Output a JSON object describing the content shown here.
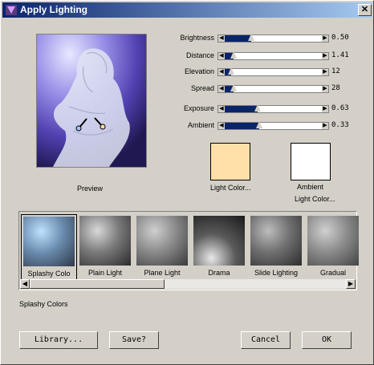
{
  "window": {
    "title": "Apply Lighting",
    "close_glyph": "✕"
  },
  "preview": {
    "label": "Preview"
  },
  "controls": [
    {
      "label": "Brightness",
      "value": "0.50",
      "level": 0.3
    },
    {
      "label": "Distance",
      "value": "1.41",
      "level": 0.14
    },
    {
      "label": "Elevation",
      "value": "12",
      "level": 0.12
    },
    {
      "label": "Spread",
      "value": "28",
      "level": 0.14
    },
    {
      "label": "Exposure",
      "value": "0.63",
      "level": 0.36
    },
    {
      "label": "Ambient",
      "value": "0.33",
      "level": 0.37
    }
  ],
  "swatches": [
    {
      "label": "Light Color...",
      "color": "#ffe0a8"
    },
    {
      "label_line1": "Ambient",
      "label_line2": "Light Color...",
      "color": "#ffffff"
    }
  ],
  "thumbnails": [
    {
      "label": "Splashy Colo",
      "selected": true
    },
    {
      "label": "Plain Light",
      "selected": false
    },
    {
      "label": "Plane Light",
      "selected": false
    },
    {
      "label": "Drama",
      "selected": false
    },
    {
      "label": "Slide Lighting",
      "selected": false
    },
    {
      "label": "Gradual",
      "selected": false
    }
  ],
  "selected_name": "Splashy Colors",
  "buttons": {
    "library": "Library...",
    "save": "Save?",
    "cancel": "Cancel",
    "ok": "OK"
  },
  "colors": {
    "title_start": "#0a246a",
    "title_end": "#a6caf0",
    "slider_fill": "#0a246a",
    "face": "#d4d0c8"
  }
}
